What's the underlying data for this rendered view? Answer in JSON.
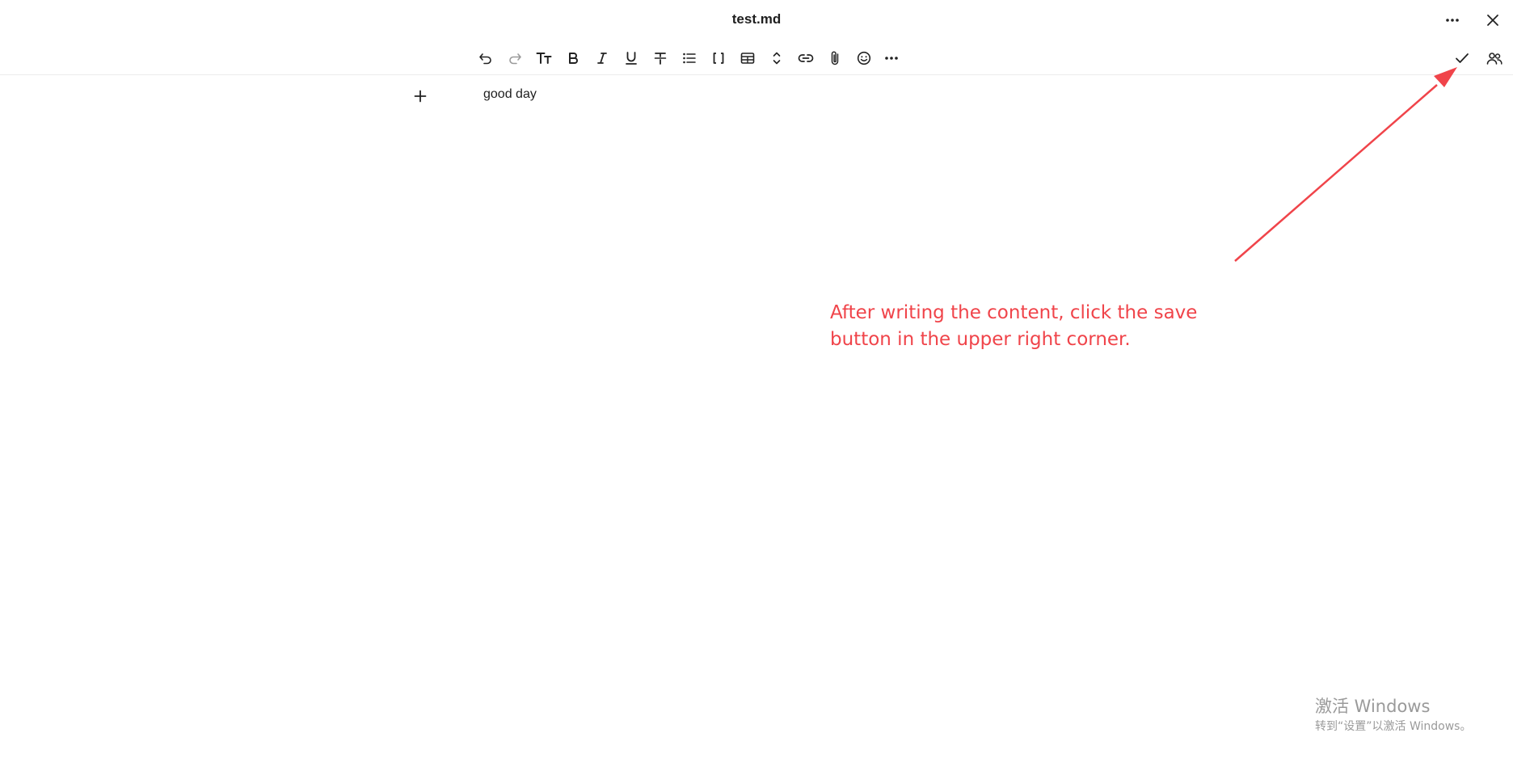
{
  "window": {
    "title": "test.md"
  },
  "toolbar": {
    "items": [
      {
        "name": "undo-button",
        "icon": "undo-icon",
        "enabled": true
      },
      {
        "name": "redo-button",
        "icon": "redo-icon",
        "enabled": false
      },
      {
        "name": "text-style-button",
        "icon": "text-size-icon",
        "label": "Tт"
      },
      {
        "name": "bold-button",
        "icon": "bold-icon",
        "label": "B"
      },
      {
        "name": "italic-button",
        "icon": "italic-icon",
        "label": "I"
      },
      {
        "name": "underline-button",
        "icon": "underline-icon",
        "label": "U"
      },
      {
        "name": "strikethrough-button",
        "icon": "strikethrough-icon"
      },
      {
        "name": "bullet-list-button",
        "icon": "bullet-list-icon"
      },
      {
        "name": "code-block-button",
        "icon": "brackets-icon",
        "label": "[ ]"
      },
      {
        "name": "table-button",
        "icon": "table-icon"
      },
      {
        "name": "expand-collapse-button",
        "icon": "chevron-up-down-icon"
      },
      {
        "name": "link-button",
        "icon": "link-icon"
      },
      {
        "name": "attachment-button",
        "icon": "paperclip-icon"
      },
      {
        "name": "emoji-button",
        "icon": "emoji-icon"
      },
      {
        "name": "more-formatting-button",
        "icon": "more-horizontal-icon"
      }
    ],
    "right": [
      {
        "name": "save-button",
        "icon": "check-icon"
      },
      {
        "name": "share-button",
        "icon": "people-icon"
      }
    ]
  },
  "editor": {
    "content": "good day"
  },
  "annotation": {
    "text": "After writing the content, click the save button in the upper right corner.",
    "color": "#f0444a"
  },
  "watermark": {
    "title": "激活 Windows",
    "subtitle": "转到“设置”以激活 Windows。"
  }
}
